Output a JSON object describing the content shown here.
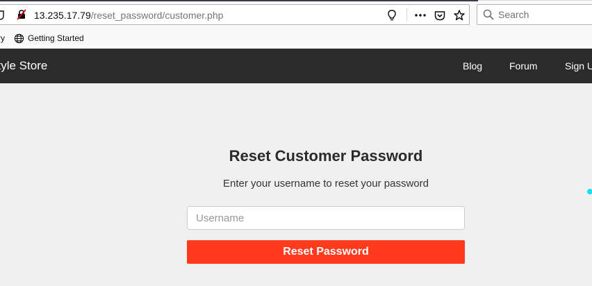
{
  "browser": {
    "url_host": "13.235.17.79",
    "url_path": "/reset_password/customer.php",
    "search_placeholder": "Search",
    "bookmarks": [
      {
        "label": "ry",
        "icon": "partial-bookmark"
      },
      {
        "label": "Getting Started",
        "icon": "globe-icon"
      }
    ],
    "icons": {
      "site_info": "shield-icon",
      "insecure_lock": "insecure-lock-icon",
      "reader": "lightbulb-icon",
      "page_actions": "more-horizontal-icon",
      "pocket": "pocket-icon",
      "bookmark": "star-icon",
      "search": "search-icon"
    }
  },
  "site": {
    "brand": "style Store",
    "nav": [
      {
        "label": "Blog"
      },
      {
        "label": "Forum"
      },
      {
        "label": "Sign U"
      }
    ]
  },
  "form": {
    "title": "Reset Customer Password",
    "subtitle": "Enter your username to reset your password",
    "username_placeholder": "Username",
    "username_value": "",
    "submit_label": "Reset Password"
  },
  "colors": {
    "header_bg": "#2b2b2b",
    "page_bg": "#f0f0f0",
    "accent_button": "#ff3a1d",
    "cursor_highlight": "#17e0f0"
  }
}
